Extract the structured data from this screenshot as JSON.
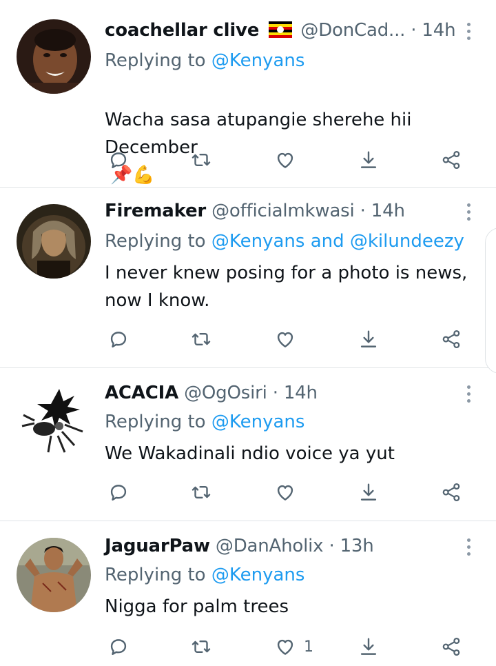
{
  "tweets": [
    {
      "name": "coachellar clive",
      "handle": "@DonCad...",
      "time": "· 14h",
      "reply_prefix": "Replying to ",
      "reply_to": "@Kenyans",
      "text": "Wacha sasa atupangie sherehe hii\nDecember",
      "emoji": [
        "📌",
        "💪"
      ],
      "flag": "Uganda flag",
      "likes": ""
    },
    {
      "name": "Firemaker",
      "handle": "@officialmkwasi",
      "time": "· 14h",
      "reply_prefix": "Replying to ",
      "reply_to": "@Kenyans and @kilundeezy",
      "text": "I never knew posing for a photo is news,\nnow I know.",
      "likes": ""
    },
    {
      "name": "ACACIA",
      "handle": "@OgOsiri",
      "time": "· 14h",
      "reply_prefix": "Replying to ",
      "reply_to": "@Kenyans",
      "text": "We Wakadinali ndio voice ya yut",
      "likes": ""
    },
    {
      "name": "JaguarPaw",
      "handle": "@DanAholix",
      "time": "· 13h",
      "reply_prefix": "Replying to ",
      "reply_to": "@Kenyans",
      "text": "Nigga for palm trees",
      "likes": "1"
    }
  ],
  "icons": [
    "reply-icon",
    "retweet-icon",
    "like-icon",
    "share-icon",
    "share-network-icon",
    "more-icon"
  ],
  "colors": {
    "accent": "#1d9bf0",
    "muted": "#536471",
    "text": "#0f1419",
    "divider": "#dfe3e6"
  }
}
